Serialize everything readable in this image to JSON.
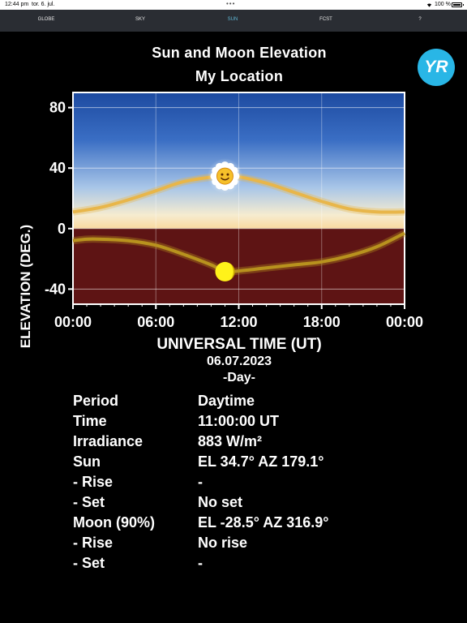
{
  "status_bar": {
    "time": "12:44 pm",
    "date": "tor. 6. jul.",
    "battery": "100 %",
    "battery_level": 1.0
  },
  "tabs": [
    {
      "label": "GLOBE",
      "active": false
    },
    {
      "label": "SKY",
      "active": false
    },
    {
      "label": "SUN",
      "active": true
    },
    {
      "label": "FCST",
      "active": false
    },
    {
      "label": "?",
      "active": false
    }
  ],
  "header": {
    "title": "Sun and Moon Elevation",
    "subtitle": "My Location",
    "logo": "YR"
  },
  "chart_data": {
    "type": "line",
    "ylabel": "ELEVATION (DEG.)",
    "xlabel": "UNIVERSAL TIME (UT)",
    "x_ticks": [
      "00:00",
      "06:00",
      "12:00",
      "18:00",
      "00:00"
    ],
    "y_ticks": [
      "80",
      "40",
      "0",
      "-40"
    ],
    "xlim": [
      0,
      24
    ],
    "ylim": [
      -50,
      90
    ],
    "grid": true,
    "series": [
      {
        "name": "Sun",
        "color": "#e8b64a",
        "x": [
          0,
          2,
          4,
          6,
          8,
          10,
          11,
          12,
          14,
          16,
          18,
          20,
          22,
          24
        ],
        "y": [
          11,
          14,
          19,
          25,
          31,
          34,
          34.7,
          34.2,
          30,
          24,
          18,
          13,
          11,
          11
        ]
      },
      {
        "name": "Moon",
        "color": "#b8921e",
        "x": [
          0,
          1,
          2,
          4,
          6,
          8,
          10,
          11,
          12,
          14,
          16,
          18,
          20,
          22,
          24
        ],
        "y": [
          -8,
          -7,
          -7,
          -8,
          -11,
          -17,
          -24,
          -28.5,
          -28,
          -26,
          -24,
          -22,
          -18,
          -12,
          -3
        ]
      }
    ],
    "marker_time": 11.0,
    "sun_marker_icon": "smiley-sun-icon",
    "moon_marker_icon": "moon-icon",
    "day_sky_color": "#3a6ec4",
    "horizon_color": "#f6e7b8",
    "below_horizon_color": "#5e1414"
  },
  "date_info": {
    "date": "06.07.2023",
    "phase": "-Day-"
  },
  "info_rows": [
    {
      "label": "Period",
      "value": "Daytime"
    },
    {
      "label": "Time",
      "value": "11:00:00 UT"
    },
    {
      "label": "Irradiance",
      "value": "883 W/m²"
    },
    {
      "label": "Sun",
      "value": "EL 34.7° AZ 179.1°"
    },
    {
      "label": "- Rise",
      "value": "-"
    },
    {
      "label": "- Set",
      "value": "No set"
    },
    {
      "label": "Moon (90%)",
      "value": "EL -28.5° AZ 316.9°"
    },
    {
      "label": "- Rise",
      "value": "No rise"
    },
    {
      "label": "- Set",
      "value": "-"
    }
  ]
}
